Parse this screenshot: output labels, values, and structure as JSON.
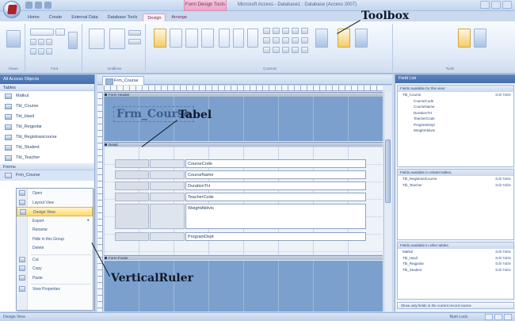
{
  "window": {
    "title": "Microsoft Access - Database1 : Database (Access 2007)",
    "context_tab_title": "Form Design Tools"
  },
  "ribbon": {
    "tabs": [
      "Home",
      "Create",
      "External Data",
      "Database Tools",
      "Design",
      "Arrange"
    ],
    "active_tab": "Design",
    "groups": [
      "Views",
      "Font",
      "Gridlines",
      "Controls",
      "Tools"
    ]
  },
  "annotations": {
    "toolbox": "Toolbox",
    "tabel": "Tabel",
    "vertical_ruler": "VerticalRuler"
  },
  "nav": {
    "header": "All Access Objects",
    "tables_group": "Tables",
    "tables": [
      "Matkul",
      "Tbl_Course",
      "Tbl_Hasil",
      "Tbl_Regpolar",
      "Tbl_Registrasicourse",
      "Tbl_Student",
      "Tbl_Teacher"
    ],
    "forms_group": "Forms",
    "forms": [
      "Frm_Course"
    ]
  },
  "context_menu": {
    "items": [
      "Open",
      "Layout View",
      "Design View",
      "Export",
      "Rename",
      "Hide in this Group",
      "Delete",
      "Cut",
      "Copy",
      "Paste",
      "View Properties"
    ],
    "highlighted": "Design View"
  },
  "document": {
    "tab_label": "Frm_Course",
    "form_title": "Frm_Course",
    "sections": {
      "header": "Form Header",
      "detail": "Detail",
      "footer": "Form Footer"
    },
    "fields": [
      "CourseCode",
      "CourseName",
      "DurationTH",
      "TeacherCode",
      "WeightAktivis",
      "ProgramDept"
    ]
  },
  "field_list": {
    "header": "Field List",
    "available_section": "Fields available for this view:",
    "related_section": "Fields available in related tables:",
    "other_section": "Fields available in other tables:",
    "table_name": "Tbl_Course",
    "fields": [
      "CourseCode",
      "CourseName",
      "DurationTH",
      "TeacherCode",
      "ProgramDept",
      "WeightAktivis"
    ],
    "related_tables": [
      "Tbl_RegistrasiCourse",
      "Tbl_Teacher"
    ],
    "other_tables": [
      "Matkul",
      "Tbl_Hasil",
      "Tbl_Regpolar",
      "Tbl_Student"
    ],
    "edit_label": "Edit Table",
    "footer": "Show only fields in the current record source"
  },
  "status": {
    "left": "Design View",
    "right": "Num Lock"
  }
}
